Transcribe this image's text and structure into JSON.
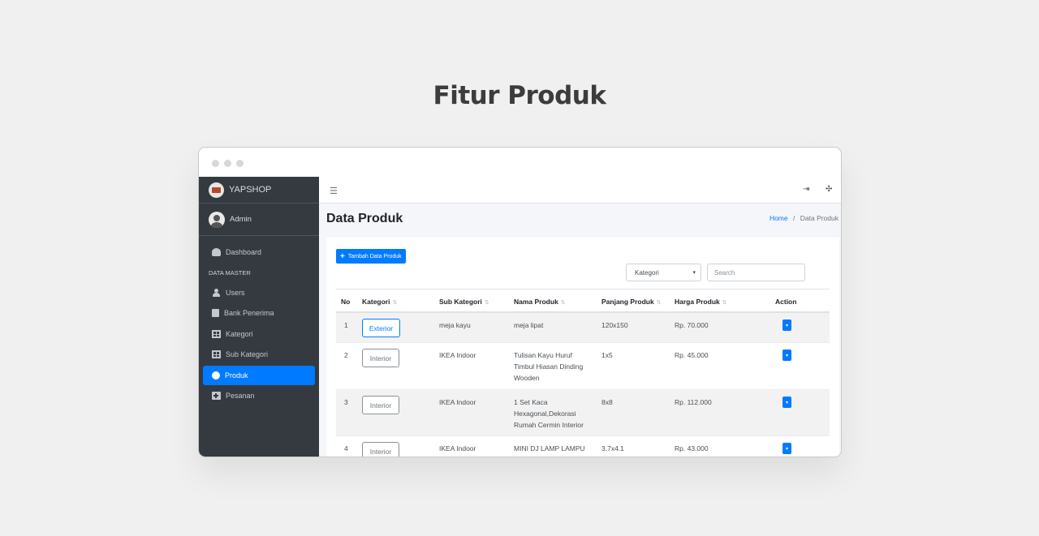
{
  "page_heading": "Fitur Produk",
  "sidebar": {
    "brand": "YAPSHOP",
    "user": "Admin",
    "items": [
      {
        "label": "Dashboard"
      },
      {
        "label": "DATA MASTER"
      },
      {
        "label": "Users"
      },
      {
        "label": "Bank Penerima"
      },
      {
        "label": "Kategori"
      },
      {
        "label": "Sub Kategori"
      },
      {
        "label": "Produk"
      },
      {
        "label": "Pesanan"
      }
    ]
  },
  "topbar": {
    "menu_icon": "hamburger-icon",
    "logout_icon": "sign-out-icon",
    "fullscreen_icon": "compress-icon"
  },
  "content": {
    "title": "Data Produk",
    "breadcrumb_home": "Home",
    "breadcrumb_sep": "/",
    "breadcrumb_current": "Data Produk"
  },
  "toolbar": {
    "add_label": "Tambah Data Produk",
    "category_select": "Kategori",
    "search_placeholder": "Search"
  },
  "table": {
    "headers": [
      "No",
      "Kategori",
      "Sub Kategori",
      "Nama Produk",
      "Panjang Produk",
      "Harga Produk",
      "Action"
    ],
    "sort_glyph": "⇅",
    "rows": [
      {
        "no": "1",
        "kategori": "Exterior",
        "sub": "meja kayu",
        "nama": [
          "meja lipat"
        ],
        "panjang": "120x150",
        "harga": "Rp. 70.000"
      },
      {
        "no": "2",
        "kategori": "Interior",
        "sub": "IKEA Indoor",
        "nama": [
          "Tulisan Kayu Huruf",
          "Timbul Hiasan Dinding",
          "Wooden"
        ],
        "panjang": "1x5",
        "harga": "Rp. 45.000"
      },
      {
        "no": "3",
        "kategori": "Interior",
        "sub": "IKEA Indoor",
        "nama": [
          "1 Set Kaca",
          "Hexagonal,Dekorasi",
          "Rumah Cermin Interior"
        ],
        "panjang": "8x8",
        "harga": "Rp. 112.000"
      },
      {
        "no": "4",
        "kategori": "Interior",
        "sub": "IKEA Indoor",
        "nama": [
          "MINI DJ LAMP LAMPU"
        ],
        "panjang": "3.7x4.1",
        "harga": "Rp. 43.000"
      }
    ]
  },
  "colors": {
    "primary": "#007bff",
    "sidebar": "#343a40"
  }
}
